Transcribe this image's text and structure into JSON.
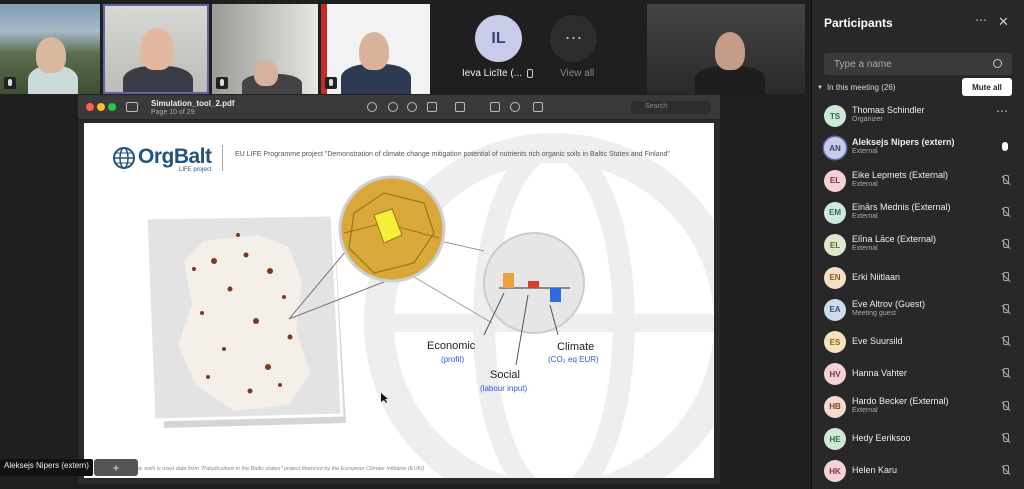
{
  "tiles": {
    "avatar_initials": "IL",
    "avatar_name": "Ieva Licīte (...",
    "view_all_label": "View all",
    "view_all_glyph": "⋯"
  },
  "pdf": {
    "file_name": "Simulation_tool_2.pdf",
    "page_info": "Page 10 of 29",
    "search_placeholder": "Search"
  },
  "slide": {
    "logo": "OrgBalt",
    "logo_sub": "LIFE project",
    "project_text": "EU LIFE Programme project \"Demonstration of climate change mitigation potential of nutrients rich organic soils in Baltic States and Finland\"",
    "economic": "Economic",
    "economic_sub": "(profit)",
    "social": "Social",
    "social_sub": "(labour input)",
    "climate": "Climate",
    "climate_sub": "(CO₂ eq EUR)",
    "footnote": "...anic soils is used data from \"Paludiculture in the Baltic states\" project financed by the European Climate Initiative (EUKI)"
  },
  "overlay": {
    "presenter_name": "Aleksejs Nipers (extern)",
    "share_glyph": "+"
  },
  "panel": {
    "title": "Participants",
    "more_glyph": "⋯",
    "close_glyph": "✕",
    "search_placeholder": "Type a name",
    "in_meeting": "In this meeting (26)",
    "mute_all": "Mute all",
    "participants": [
      {
        "initials": "TS",
        "name": "Thomas Schindler",
        "role": "Organizer",
        "color": "#cfe8d7",
        "text": "#2d6b42",
        "status": "more"
      },
      {
        "initials": "AN",
        "name": "Aleksejs Nipers (extern)",
        "role": "External",
        "color": "#c9cbeb",
        "text": "#3f3f75",
        "status": "speaking"
      },
      {
        "initials": "EL",
        "name": "Eike Lepmets (External)",
        "role": "External",
        "color": "#f3d2d8",
        "text": "#8a2e3e",
        "status": "muted"
      },
      {
        "initials": "EM",
        "name": "Einārs Mednis (External)",
        "role": "External",
        "color": "#cfe8e2",
        "text": "#2d6b5c",
        "status": "muted"
      },
      {
        "initials": "EL",
        "name": "Elīna Lāce (External)",
        "role": "External",
        "color": "#dfe8cf",
        "text": "#4e6b2d",
        "status": "muted"
      },
      {
        "initials": "EN",
        "name": "Erki Niitlaan",
        "role": "",
        "color": "#f6e0c8",
        "text": "#8a5a24",
        "status": "muted"
      },
      {
        "initials": "EA",
        "name": "Eve Altrov (Guest)",
        "role": "Meeting guest",
        "color": "#cfdced",
        "text": "#2d4f7a",
        "status": "muted"
      },
      {
        "initials": "ES",
        "name": "Eve Suursild",
        "role": "",
        "color": "#f6e2bf",
        "text": "#8a6218",
        "status": "muted"
      },
      {
        "initials": "HV",
        "name": "Hanna Vahter",
        "role": "",
        "color": "#f3d2d8",
        "text": "#8a2e3e",
        "status": "muted"
      },
      {
        "initials": "HB",
        "name": "Hardo Becker (External)",
        "role": "External",
        "color": "#f6d9cf",
        "text": "#8a3e24",
        "status": "muted"
      },
      {
        "initials": "HE",
        "name": "Hedy Eeriksoo",
        "role": "",
        "color": "#cfe8d7",
        "text": "#2d6b42",
        "status": "muted"
      },
      {
        "initials": "HK",
        "name": "Helen Karu",
        "role": "",
        "color": "#f3d2d8",
        "text": "#8a2e3e",
        "status": "muted"
      }
    ]
  },
  "colors": {
    "brand": "#6264a7",
    "orgbalt_blue": "#23547e",
    "lens_gold": "#d8a83a",
    "bar_economic": "#e8a33a",
    "bar_social": "#d9402b",
    "bar_climate": "#2f6be0"
  }
}
